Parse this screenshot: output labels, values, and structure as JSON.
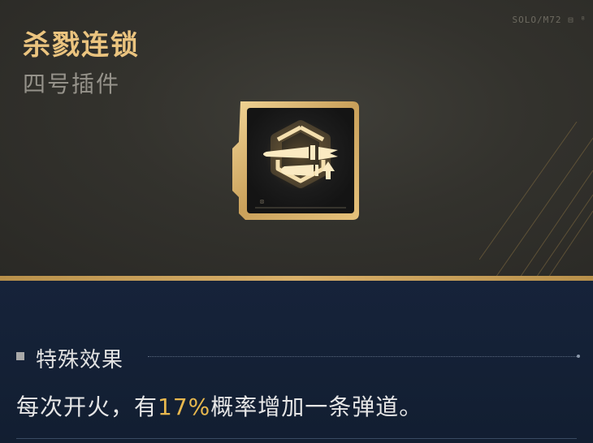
{
  "item": {
    "name": "杀戮连锁",
    "type": "四号插件",
    "icon": "bullet-upgrade-icon",
    "corner_tag": "SOLO/M72 ⊟ ⁸"
  },
  "effect": {
    "header": "特殊效果",
    "text_before": "每次开火，有",
    "highlight": "17%",
    "text_after": "概率增加一条弹道。"
  },
  "colors": {
    "title_gold": "#ebc47f",
    "highlight_gold": "#e8b84e",
    "divider_gold": "#d9b06a",
    "top_bg": "#33322d",
    "bottom_bg": "#16233a"
  }
}
